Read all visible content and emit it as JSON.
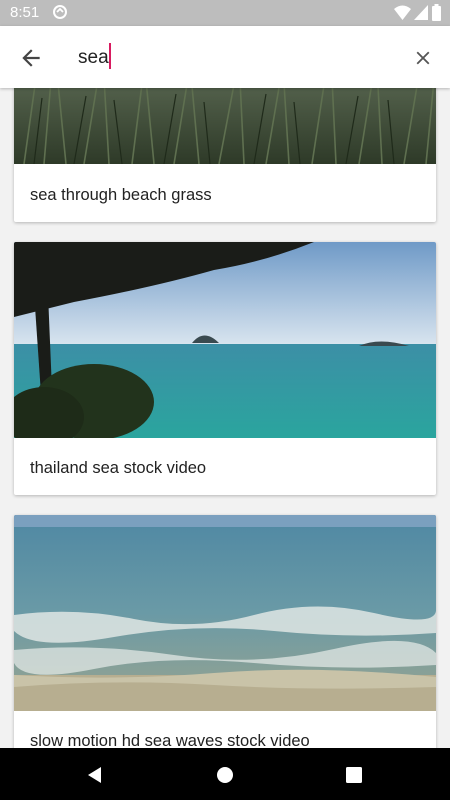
{
  "status": {
    "time": "8:51"
  },
  "search": {
    "query": "sea"
  },
  "results": [
    {
      "title": "sea through beach grass"
    },
    {
      "title": "thailand sea stock video"
    },
    {
      "title": "slow motion hd sea waves stock video"
    }
  ],
  "icons": {
    "back": "arrow-back-icon",
    "clear": "close-icon",
    "wifi": "wifi-icon",
    "signal": "cell-signal-icon",
    "battery": "battery-icon",
    "nav_back": "nav-back-icon",
    "nav_home": "nav-home-icon",
    "nav_recents": "nav-recents-icon"
  },
  "colors": {
    "status_bar": "#bdbdbd",
    "cursor_accent": "#d81b60",
    "background": "#f2f2f2",
    "nav_bar": "#000000"
  }
}
